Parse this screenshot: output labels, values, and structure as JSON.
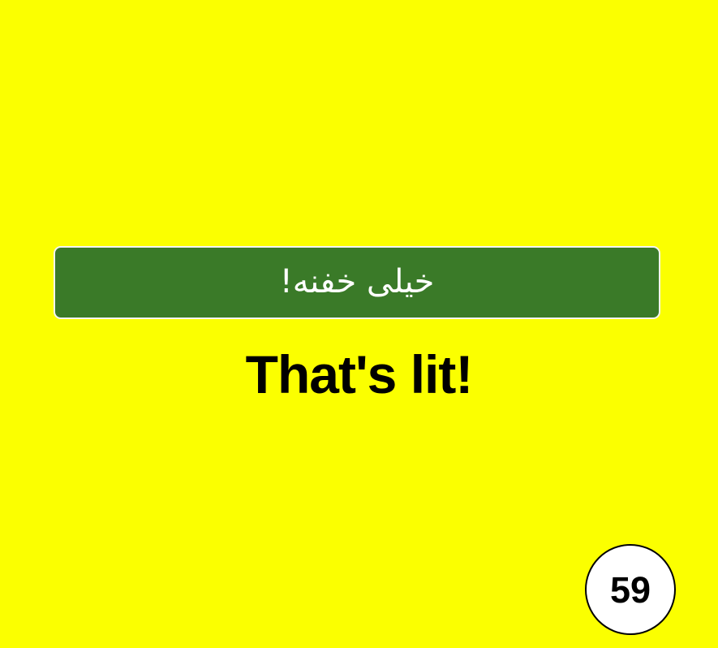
{
  "card": {
    "persian_phrase": "خیلی خفنه!",
    "english_translation": "That's lit!",
    "number": "59",
    "colors": {
      "background": "#fbff00",
      "banner": "#3a7a28",
      "banner_text": "#ffffff",
      "english_text": "#000000",
      "badge_background": "#ffffff",
      "badge_border": "#000000"
    }
  }
}
